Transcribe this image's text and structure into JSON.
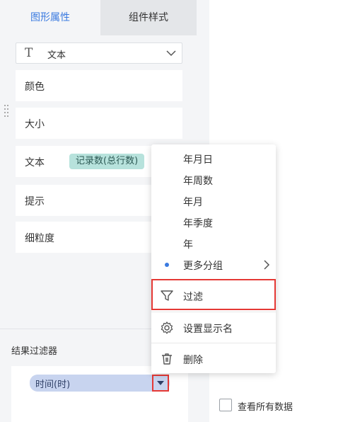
{
  "tabs": {
    "active": "图形属性",
    "inactive": "组件样式"
  },
  "type_select": {
    "icon": "text-type-icon",
    "value": "文本"
  },
  "properties": [
    {
      "label": "颜色"
    },
    {
      "label": "大小"
    },
    {
      "label": "文本",
      "chip": "记录数(总行数)"
    },
    {
      "label": "提示"
    },
    {
      "label": "细粒度"
    }
  ],
  "filter": {
    "title": "结果过滤器",
    "field": "时间(时)"
  },
  "menu": {
    "items": [
      {
        "label": "年月日"
      },
      {
        "label": "年周数"
      },
      {
        "label": "年月"
      },
      {
        "label": "年季度"
      },
      {
        "label": "年"
      },
      {
        "label": "更多分组",
        "selected": true,
        "has_submenu": true
      }
    ],
    "filter_label": "过滤",
    "rename_label": "设置显示名",
    "delete_label": "删除"
  },
  "show_all": {
    "label": "查看所有数据",
    "checked": false
  },
  "colors": {
    "accent": "#3a7ae0",
    "chip_bg": "#b7e2dc",
    "field_bg": "#c8d4ef",
    "highlight": "#e53935"
  }
}
